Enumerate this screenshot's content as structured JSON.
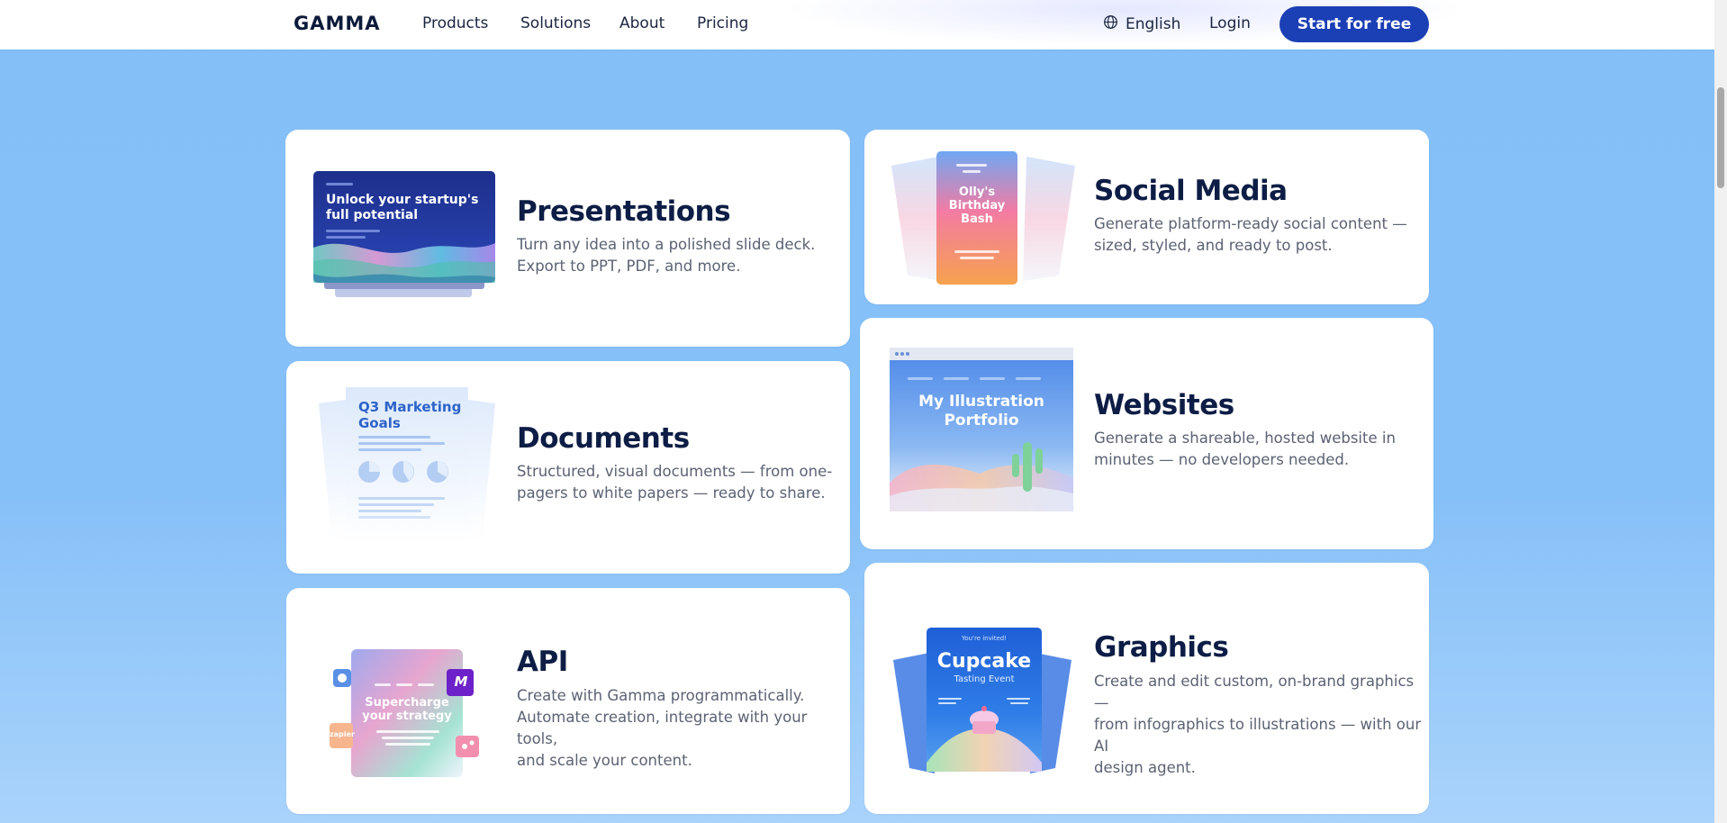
{
  "nav": {
    "logo": "GAMMA",
    "links": [
      "Products",
      "Solutions",
      "About",
      "Pricing"
    ],
    "language": "English",
    "login": "Login",
    "cta": "Start for free"
  },
  "cards": {
    "presentations": {
      "title": "Presentations",
      "desc_line1": "Turn any idea into a polished slide deck.",
      "desc_line2": "Export to PPT, PDF, and more.",
      "thumb_text_1": "Unlock your startup's",
      "thumb_text_2": "full potential"
    },
    "social": {
      "title": "Social Media",
      "desc_line1": "Generate platform-ready social content —",
      "desc_line2": "sized, styled, and ready to post.",
      "thumb_text_1": "Olly's",
      "thumb_text_2": "Birthday",
      "thumb_text_3": "Bash"
    },
    "documents": {
      "title": "Documents",
      "desc_line1": "Structured, visual documents — from one-",
      "desc_line2": "pagers to white papers — ready to share.",
      "thumb_text_1": "Q3 Marketing",
      "thumb_text_2": "Goals"
    },
    "websites": {
      "title": "Websites",
      "desc_line1": "Generate a shareable, hosted website in",
      "desc_line2": "minutes — no developers needed.",
      "thumb_text_1": "My Illustration",
      "thumb_text_2": "Portfolio"
    },
    "api": {
      "title": "API",
      "desc_line1": "Create with Gamma programmatically.",
      "desc_line2": "Automate creation, integrate with your tools,",
      "desc_line3": "and scale your content.",
      "thumb_text_1": "Supercharge",
      "thumb_text_2": "your strategy",
      "badge_make": "M",
      "badge_zapier": "zapier"
    },
    "graphics": {
      "title": "Graphics",
      "desc_line1": "Create and edit custom, on-brand graphics —",
      "desc_line2": "from infographics to illustrations — with our AI",
      "desc_line3": "design agent.",
      "thumb_small": "You're invited!",
      "thumb_text_1": "Cupcake",
      "thumb_text_2": "Tasting Event"
    }
  },
  "colors": {
    "accent": "#1b3fb5",
    "background": "#86c0f8",
    "title": "#0d1d45"
  }
}
